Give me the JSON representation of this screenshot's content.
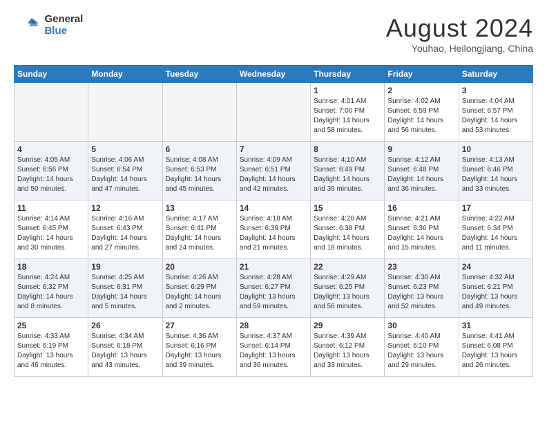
{
  "header": {
    "logo_line1": "General",
    "logo_line2": "Blue",
    "title": "August 2024",
    "subtitle": "Youhao, Heilongjiang, China"
  },
  "days_of_week": [
    "Sunday",
    "Monday",
    "Tuesday",
    "Wednesday",
    "Thursday",
    "Friday",
    "Saturday"
  ],
  "weeks": [
    {
      "days": [
        {
          "num": "",
          "text": "",
          "empty": true
        },
        {
          "num": "",
          "text": "",
          "empty": true
        },
        {
          "num": "",
          "text": "",
          "empty": true
        },
        {
          "num": "",
          "text": "",
          "empty": true
        },
        {
          "num": "1",
          "text": "Sunrise: 4:01 AM\nSunset: 7:00 PM\nDaylight: 14 hours\nand 58 minutes.",
          "empty": false
        },
        {
          "num": "2",
          "text": "Sunrise: 4:02 AM\nSunset: 6:59 PM\nDaylight: 14 hours\nand 56 minutes.",
          "empty": false
        },
        {
          "num": "3",
          "text": "Sunrise: 4:04 AM\nSunset: 6:57 PM\nDaylight: 14 hours\nand 53 minutes.",
          "empty": false
        }
      ]
    },
    {
      "days": [
        {
          "num": "4",
          "text": "Sunrise: 4:05 AM\nSunset: 6:56 PM\nDaylight: 14 hours\nand 50 minutes.",
          "empty": false
        },
        {
          "num": "5",
          "text": "Sunrise: 4:06 AM\nSunset: 6:54 PM\nDaylight: 14 hours\nand 47 minutes.",
          "empty": false
        },
        {
          "num": "6",
          "text": "Sunrise: 4:08 AM\nSunset: 6:53 PM\nDaylight: 14 hours\nand 45 minutes.",
          "empty": false
        },
        {
          "num": "7",
          "text": "Sunrise: 4:09 AM\nSunset: 6:51 PM\nDaylight: 14 hours\nand 42 minutes.",
          "empty": false
        },
        {
          "num": "8",
          "text": "Sunrise: 4:10 AM\nSunset: 6:49 PM\nDaylight: 14 hours\nand 39 minutes.",
          "empty": false
        },
        {
          "num": "9",
          "text": "Sunrise: 4:12 AM\nSunset: 6:48 PM\nDaylight: 14 hours\nand 36 minutes.",
          "empty": false
        },
        {
          "num": "10",
          "text": "Sunrise: 4:13 AM\nSunset: 6:46 PM\nDaylight: 14 hours\nand 33 minutes.",
          "empty": false
        }
      ]
    },
    {
      "days": [
        {
          "num": "11",
          "text": "Sunrise: 4:14 AM\nSunset: 6:45 PM\nDaylight: 14 hours\nand 30 minutes.",
          "empty": false
        },
        {
          "num": "12",
          "text": "Sunrise: 4:16 AM\nSunset: 6:43 PM\nDaylight: 14 hours\nand 27 minutes.",
          "empty": false
        },
        {
          "num": "13",
          "text": "Sunrise: 4:17 AM\nSunset: 6:41 PM\nDaylight: 14 hours\nand 24 minutes.",
          "empty": false
        },
        {
          "num": "14",
          "text": "Sunrise: 4:18 AM\nSunset: 6:39 PM\nDaylight: 14 hours\nand 21 minutes.",
          "empty": false
        },
        {
          "num": "15",
          "text": "Sunrise: 4:20 AM\nSunset: 6:38 PM\nDaylight: 14 hours\nand 18 minutes.",
          "empty": false
        },
        {
          "num": "16",
          "text": "Sunrise: 4:21 AM\nSunset: 6:36 PM\nDaylight: 14 hours\nand 15 minutes.",
          "empty": false
        },
        {
          "num": "17",
          "text": "Sunrise: 4:22 AM\nSunset: 6:34 PM\nDaylight: 14 hours\nand 11 minutes.",
          "empty": false
        }
      ]
    },
    {
      "days": [
        {
          "num": "18",
          "text": "Sunrise: 4:24 AM\nSunset: 6:32 PM\nDaylight: 14 hours\nand 8 minutes.",
          "empty": false
        },
        {
          "num": "19",
          "text": "Sunrise: 4:25 AM\nSunset: 6:31 PM\nDaylight: 14 hours\nand 5 minutes.",
          "empty": false
        },
        {
          "num": "20",
          "text": "Sunrise: 4:26 AM\nSunset: 6:29 PM\nDaylight: 14 hours\nand 2 minutes.",
          "empty": false
        },
        {
          "num": "21",
          "text": "Sunrise: 4:28 AM\nSunset: 6:27 PM\nDaylight: 13 hours\nand 59 minutes.",
          "empty": false
        },
        {
          "num": "22",
          "text": "Sunrise: 4:29 AM\nSunset: 6:25 PM\nDaylight: 13 hours\nand 56 minutes.",
          "empty": false
        },
        {
          "num": "23",
          "text": "Sunrise: 4:30 AM\nSunset: 6:23 PM\nDaylight: 13 hours\nand 52 minutes.",
          "empty": false
        },
        {
          "num": "24",
          "text": "Sunrise: 4:32 AM\nSunset: 6:21 PM\nDaylight: 13 hours\nand 49 minutes.",
          "empty": false
        }
      ]
    },
    {
      "days": [
        {
          "num": "25",
          "text": "Sunrise: 4:33 AM\nSunset: 6:19 PM\nDaylight: 13 hours\nand 46 minutes.",
          "empty": false
        },
        {
          "num": "26",
          "text": "Sunrise: 4:34 AM\nSunset: 6:18 PM\nDaylight: 13 hours\nand 43 minutes.",
          "empty": false
        },
        {
          "num": "27",
          "text": "Sunrise: 4:36 AM\nSunset: 6:16 PM\nDaylight: 13 hours\nand 39 minutes.",
          "empty": false
        },
        {
          "num": "28",
          "text": "Sunrise: 4:37 AM\nSunset: 6:14 PM\nDaylight: 13 hours\nand 36 minutes.",
          "empty": false
        },
        {
          "num": "29",
          "text": "Sunrise: 4:39 AM\nSunset: 6:12 PM\nDaylight: 13 hours\nand 33 minutes.",
          "empty": false
        },
        {
          "num": "30",
          "text": "Sunrise: 4:40 AM\nSunset: 6:10 PM\nDaylight: 13 hours\nand 29 minutes.",
          "empty": false
        },
        {
          "num": "31",
          "text": "Sunrise: 4:41 AM\nSunset: 6:08 PM\nDaylight: 13 hours\nand 26 minutes.",
          "empty": false
        }
      ]
    }
  ]
}
